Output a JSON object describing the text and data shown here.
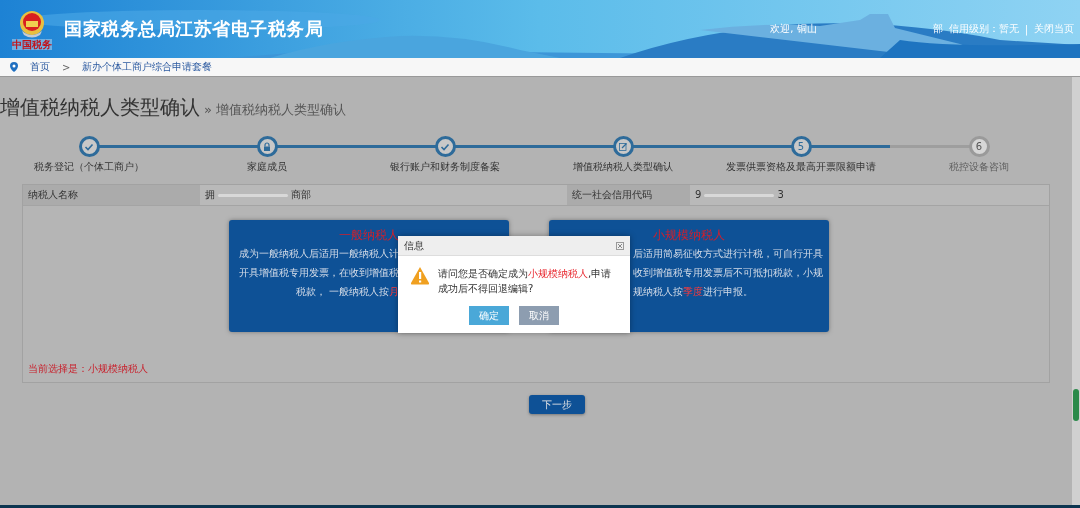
{
  "header": {
    "emblem_caption": "中国税务",
    "title": "国家税务总局江苏省电子税务局",
    "welcome": "欢迎, 铜山",
    "department": "部",
    "credit": "信用级别：暂无",
    "separator": "|",
    "close_link": "关闭当页"
  },
  "breadcrumb": [
    "首页",
    ">",
    "新办个体工商户综合申请套餐"
  ],
  "page_title": "增值税纳税人类型确认",
  "page_subtitle": "» 增值税纳税人类型确认",
  "steps": [
    {
      "kind": "check",
      "label": "税务登记（个体工商户）",
      "active": true
    },
    {
      "kind": "lock",
      "label": "家庭成员",
      "active": true
    },
    {
      "kind": "check",
      "label": "银行账户和财务制度备案",
      "active": true
    },
    {
      "kind": "edit",
      "label": "增值税纳税人类型确认",
      "active": true
    },
    {
      "kind": "number",
      "number": "5",
      "label": "发票供票资格及最高开票限额申请",
      "active": true
    },
    {
      "kind": "number",
      "number": "6",
      "label": "税控设备咨询",
      "active": false
    }
  ],
  "info": [
    {
      "label": "纳税人名称",
      "value_start": "拥",
      "value_end": "商部"
    },
    {
      "label": "统一社会信用代码",
      "value_start": "9",
      "value_end": "3"
    }
  ],
  "cards": [
    {
      "title": "一般纳税人",
      "lines": [
        [
          {
            "text": "成为一般纳税人后适用一般纳税人计",
            "highlight": false
          }
        ],
        [
          {
            "text": "开具增值税专用发票，在收到增值税",
            "highlight": false
          }
        ],
        [
          {
            "text": "税款， 一般纳税人按",
            "highlight": false
          },
          {
            "text": "月",
            "highlight": true
          }
        ]
      ]
    },
    {
      "title": "小规模纳税人",
      "lines": [
        [
          {
            "text": "后适用简易征收方式进行计税，可自行开具",
            "highlight": false
          }
        ],
        [
          {
            "text": "收到增值税专用发票后不可抵扣税款，小规",
            "highlight": false
          }
        ],
        [
          {
            "text": "规纳税人按",
            "highlight": false
          },
          {
            "text": "季度",
            "highlight": true
          },
          {
            "text": "进行申报。",
            "highlight": false
          }
        ]
      ]
    }
  ],
  "current_choice": "当前选择是：小规模纳税人",
  "next_button": "下一步",
  "dialog": {
    "title": "信息",
    "message": [
      {
        "text": "请问您是否确定成为",
        "highlight": false
      },
      {
        "text": "小规模纳税人",
        "highlight": true
      },
      {
        "text": ",申请成功后不得回退编辑?",
        "highlight": false
      }
    ],
    "buttons": [
      {
        "label": "确定",
        "disabled": false
      },
      {
        "label": "取消",
        "disabled": true
      }
    ]
  }
}
